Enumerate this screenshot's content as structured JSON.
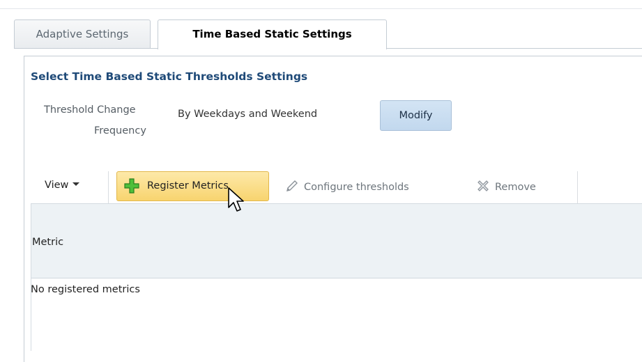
{
  "tabs": [
    {
      "label": "Adaptive Settings",
      "active": false
    },
    {
      "label": "Time Based Static Settings",
      "active": true
    }
  ],
  "section": {
    "title": "Select Time Based Static Thresholds Settings",
    "threshold_label_line1": "Threshold Change",
    "threshold_label_line2": "Frequency",
    "threshold_value": "By Weekdays and Weekend",
    "modify_label": "Modify"
  },
  "toolbar": {
    "view_label": "View",
    "register_label": "Register Metrics",
    "configure_label": "Configure thresholds",
    "remove_label": "Remove"
  },
  "table": {
    "columns": [
      "Metric"
    ],
    "empty_message": "No registered metrics"
  },
  "colors": {
    "accent_title": "#1f4a78",
    "register_bg": "#f8d46f",
    "modify_bg": "#c2d8ee",
    "header_bg": "#edf2f5"
  }
}
